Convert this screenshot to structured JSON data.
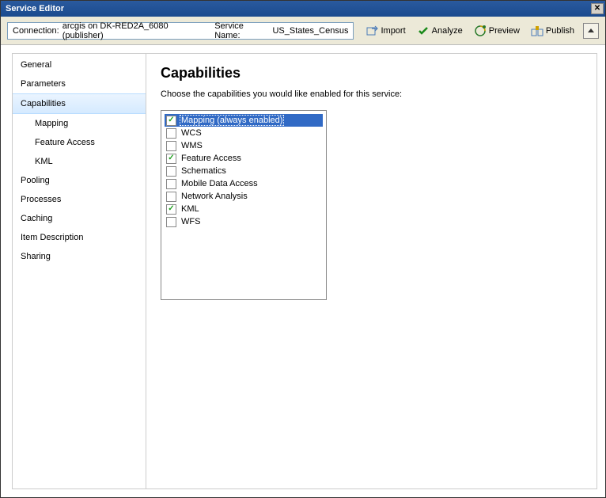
{
  "window": {
    "title": "Service Editor"
  },
  "toolbar": {
    "connection_label": "Connection:",
    "connection_value": "arcgis on DK-RED2A_6080 (publisher)",
    "service_name_label": "Service Name:",
    "service_name_value": "US_States_Census",
    "import_label": "Import",
    "analyze_label": "Analyze",
    "preview_label": "Preview",
    "publish_label": "Publish"
  },
  "sidebar": {
    "items": [
      {
        "label": "General",
        "selected": false,
        "sub": false
      },
      {
        "label": "Parameters",
        "selected": false,
        "sub": false
      },
      {
        "label": "Capabilities",
        "selected": true,
        "sub": false
      },
      {
        "label": "Mapping",
        "selected": false,
        "sub": true
      },
      {
        "label": "Feature Access",
        "selected": false,
        "sub": true
      },
      {
        "label": "KML",
        "selected": false,
        "sub": true
      },
      {
        "label": "Pooling",
        "selected": false,
        "sub": false
      },
      {
        "label": "Processes",
        "selected": false,
        "sub": false
      },
      {
        "label": "Caching",
        "selected": false,
        "sub": false
      },
      {
        "label": "Item Description",
        "selected": false,
        "sub": false
      },
      {
        "label": "Sharing",
        "selected": false,
        "sub": false
      }
    ]
  },
  "main": {
    "heading": "Capabilities",
    "subtitle": "Choose the capabilities you would like enabled for this service:",
    "capabilities": [
      {
        "label": "Mapping (always enabled)",
        "checked": true,
        "highlighted": true
      },
      {
        "label": "WCS",
        "checked": false,
        "highlighted": false
      },
      {
        "label": "WMS",
        "checked": false,
        "highlighted": false
      },
      {
        "label": "Feature Access",
        "checked": true,
        "highlighted": false
      },
      {
        "label": "Schematics",
        "checked": false,
        "highlighted": false
      },
      {
        "label": "Mobile Data Access",
        "checked": false,
        "highlighted": false
      },
      {
        "label": "Network Analysis",
        "checked": false,
        "highlighted": false
      },
      {
        "label": "KML",
        "checked": true,
        "highlighted": false
      },
      {
        "label": "WFS",
        "checked": false,
        "highlighted": false
      }
    ]
  }
}
